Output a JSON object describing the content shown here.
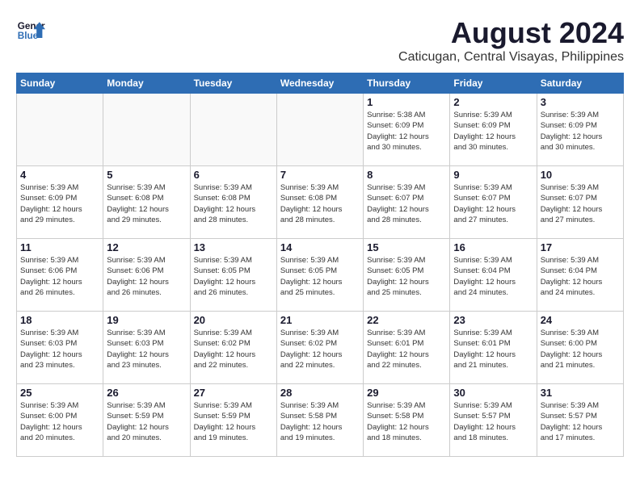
{
  "header": {
    "logo_line1": "General",
    "logo_line2": "Blue",
    "month": "August 2024",
    "location": "Caticugan, Central Visayas, Philippines"
  },
  "weekdays": [
    "Sunday",
    "Monday",
    "Tuesday",
    "Wednesday",
    "Thursday",
    "Friday",
    "Saturday"
  ],
  "weeks": [
    [
      {
        "day": "",
        "info": ""
      },
      {
        "day": "",
        "info": ""
      },
      {
        "day": "",
        "info": ""
      },
      {
        "day": "",
        "info": ""
      },
      {
        "day": "1",
        "info": "Sunrise: 5:38 AM\nSunset: 6:09 PM\nDaylight: 12 hours\nand 30 minutes."
      },
      {
        "day": "2",
        "info": "Sunrise: 5:39 AM\nSunset: 6:09 PM\nDaylight: 12 hours\nand 30 minutes."
      },
      {
        "day": "3",
        "info": "Sunrise: 5:39 AM\nSunset: 6:09 PM\nDaylight: 12 hours\nand 30 minutes."
      }
    ],
    [
      {
        "day": "4",
        "info": "Sunrise: 5:39 AM\nSunset: 6:09 PM\nDaylight: 12 hours\nand 29 minutes."
      },
      {
        "day": "5",
        "info": "Sunrise: 5:39 AM\nSunset: 6:08 PM\nDaylight: 12 hours\nand 29 minutes."
      },
      {
        "day": "6",
        "info": "Sunrise: 5:39 AM\nSunset: 6:08 PM\nDaylight: 12 hours\nand 28 minutes."
      },
      {
        "day": "7",
        "info": "Sunrise: 5:39 AM\nSunset: 6:08 PM\nDaylight: 12 hours\nand 28 minutes."
      },
      {
        "day": "8",
        "info": "Sunrise: 5:39 AM\nSunset: 6:07 PM\nDaylight: 12 hours\nand 28 minutes."
      },
      {
        "day": "9",
        "info": "Sunrise: 5:39 AM\nSunset: 6:07 PM\nDaylight: 12 hours\nand 27 minutes."
      },
      {
        "day": "10",
        "info": "Sunrise: 5:39 AM\nSunset: 6:07 PM\nDaylight: 12 hours\nand 27 minutes."
      }
    ],
    [
      {
        "day": "11",
        "info": "Sunrise: 5:39 AM\nSunset: 6:06 PM\nDaylight: 12 hours\nand 26 minutes."
      },
      {
        "day": "12",
        "info": "Sunrise: 5:39 AM\nSunset: 6:06 PM\nDaylight: 12 hours\nand 26 minutes."
      },
      {
        "day": "13",
        "info": "Sunrise: 5:39 AM\nSunset: 6:05 PM\nDaylight: 12 hours\nand 26 minutes."
      },
      {
        "day": "14",
        "info": "Sunrise: 5:39 AM\nSunset: 6:05 PM\nDaylight: 12 hours\nand 25 minutes."
      },
      {
        "day": "15",
        "info": "Sunrise: 5:39 AM\nSunset: 6:05 PM\nDaylight: 12 hours\nand 25 minutes."
      },
      {
        "day": "16",
        "info": "Sunrise: 5:39 AM\nSunset: 6:04 PM\nDaylight: 12 hours\nand 24 minutes."
      },
      {
        "day": "17",
        "info": "Sunrise: 5:39 AM\nSunset: 6:04 PM\nDaylight: 12 hours\nand 24 minutes."
      }
    ],
    [
      {
        "day": "18",
        "info": "Sunrise: 5:39 AM\nSunset: 6:03 PM\nDaylight: 12 hours\nand 23 minutes."
      },
      {
        "day": "19",
        "info": "Sunrise: 5:39 AM\nSunset: 6:03 PM\nDaylight: 12 hours\nand 23 minutes."
      },
      {
        "day": "20",
        "info": "Sunrise: 5:39 AM\nSunset: 6:02 PM\nDaylight: 12 hours\nand 22 minutes."
      },
      {
        "day": "21",
        "info": "Sunrise: 5:39 AM\nSunset: 6:02 PM\nDaylight: 12 hours\nand 22 minutes."
      },
      {
        "day": "22",
        "info": "Sunrise: 5:39 AM\nSunset: 6:01 PM\nDaylight: 12 hours\nand 22 minutes."
      },
      {
        "day": "23",
        "info": "Sunrise: 5:39 AM\nSunset: 6:01 PM\nDaylight: 12 hours\nand 21 minutes."
      },
      {
        "day": "24",
        "info": "Sunrise: 5:39 AM\nSunset: 6:00 PM\nDaylight: 12 hours\nand 21 minutes."
      }
    ],
    [
      {
        "day": "25",
        "info": "Sunrise: 5:39 AM\nSunset: 6:00 PM\nDaylight: 12 hours\nand 20 minutes."
      },
      {
        "day": "26",
        "info": "Sunrise: 5:39 AM\nSunset: 5:59 PM\nDaylight: 12 hours\nand 20 minutes."
      },
      {
        "day": "27",
        "info": "Sunrise: 5:39 AM\nSunset: 5:59 PM\nDaylight: 12 hours\nand 19 minutes."
      },
      {
        "day": "28",
        "info": "Sunrise: 5:39 AM\nSunset: 5:58 PM\nDaylight: 12 hours\nand 19 minutes."
      },
      {
        "day": "29",
        "info": "Sunrise: 5:39 AM\nSunset: 5:58 PM\nDaylight: 12 hours\nand 18 minutes."
      },
      {
        "day": "30",
        "info": "Sunrise: 5:39 AM\nSunset: 5:57 PM\nDaylight: 12 hours\nand 18 minutes."
      },
      {
        "day": "31",
        "info": "Sunrise: 5:39 AM\nSunset: 5:57 PM\nDaylight: 12 hours\nand 17 minutes."
      }
    ]
  ]
}
